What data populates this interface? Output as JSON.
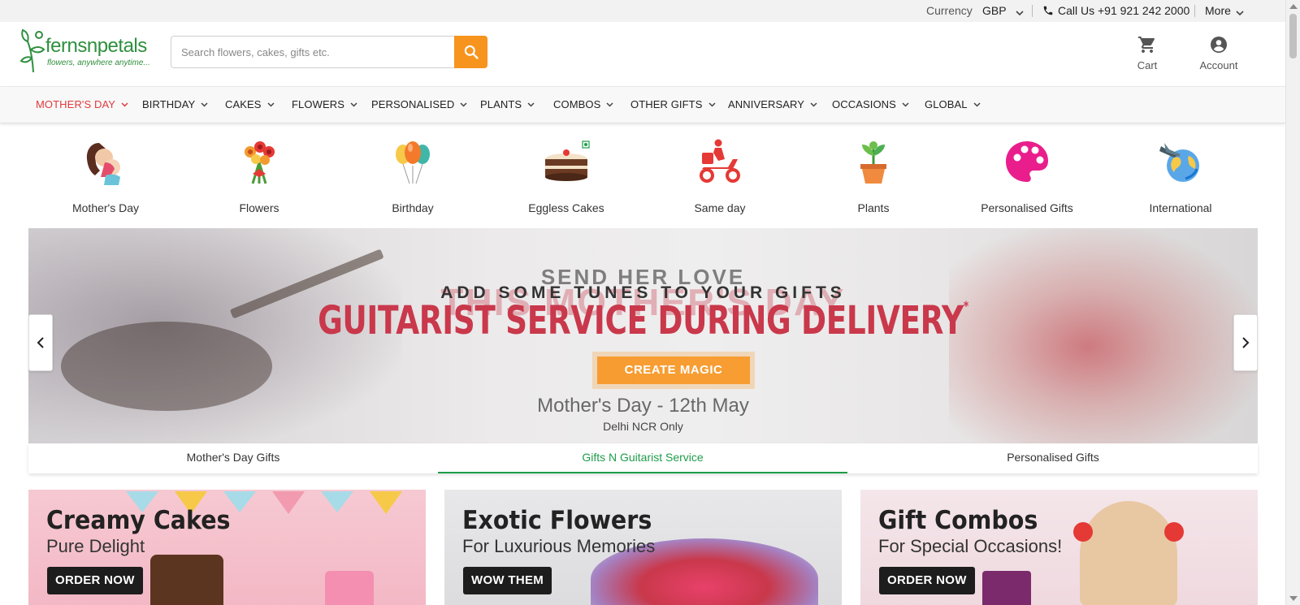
{
  "topbar": {
    "currency_label": "Currency",
    "currency_value": "GBP",
    "call_label": "Call Us +91 921 242 2000",
    "more_label": "More"
  },
  "header": {
    "logo_text": "fernsnpetals",
    "logo_tagline": "flowers, anywhere anytime...",
    "search_placeholder": "Search flowers, cakes, gifts etc.",
    "cart_label": "Cart",
    "account_label": "Account"
  },
  "nav": {
    "items": [
      {
        "label": "MOTHER'S DAY",
        "active": true
      },
      {
        "label": "BIRTHDAY"
      },
      {
        "label": "CAKES"
      },
      {
        "label": "FLOWERS"
      },
      {
        "label": "PERSONALISED"
      },
      {
        "label": "PLANTS"
      },
      {
        "label": "COMBOS"
      },
      {
        "label": "OTHER GIFTS"
      },
      {
        "label": "ANNIVERSARY"
      },
      {
        "label": "OCCASIONS"
      },
      {
        "label": "GLOBAL"
      }
    ]
  },
  "categories": [
    {
      "label": "Mother's Day",
      "icon": "mother-child-icon"
    },
    {
      "label": "Flowers",
      "icon": "flower-bouquet-icon"
    },
    {
      "label": "Birthday",
      "icon": "balloons-icon"
    },
    {
      "label": "Eggless Cakes",
      "icon": "cake-icon"
    },
    {
      "label": "Same day",
      "icon": "delivery-scooter-icon"
    },
    {
      "label": "Plants",
      "icon": "potted-plant-icon"
    },
    {
      "label": "Personalised Gifts",
      "icon": "palette-icon"
    },
    {
      "label": "International",
      "icon": "globe-plane-icon"
    }
  ],
  "banner": {
    "ghost_heading": "THIS MOTHER'S DAY",
    "subheading_1": "SEND HER LOVE",
    "subheading_2": "ADD SOME TUNES TO YOUR GIFTS",
    "heading": "GUITARIST SERVICE DURING DELIVERY",
    "heading_mark": "*",
    "cta_label": "CREATE MAGIC",
    "date_text": "Mother's Day - 12th May",
    "note": "Delhi NCR Only",
    "prev_label": "‹",
    "next_label": "›",
    "tabs": [
      {
        "label": "Mother's Day Gifts"
      },
      {
        "label": "Gifts N Guitarist Service",
        "active": true
      },
      {
        "label": "Personalised Gifts"
      }
    ]
  },
  "promos": [
    {
      "title": "Creamy Cakes",
      "subtitle": "Pure Delight",
      "cta": "ORDER NOW"
    },
    {
      "title": "Exotic Flowers",
      "subtitle": "For Luxurious Memories",
      "cta": "WOW THEM"
    },
    {
      "title": "Gift Combos",
      "subtitle": "For Special Occasions!",
      "cta": "ORDER NOW"
    }
  ],
  "colors": {
    "brand_green": "#2f8f3e",
    "accent_orange": "#f7941d",
    "active_nav_red": "#e03a3e",
    "active_tab_green": "#1e9d4a"
  }
}
